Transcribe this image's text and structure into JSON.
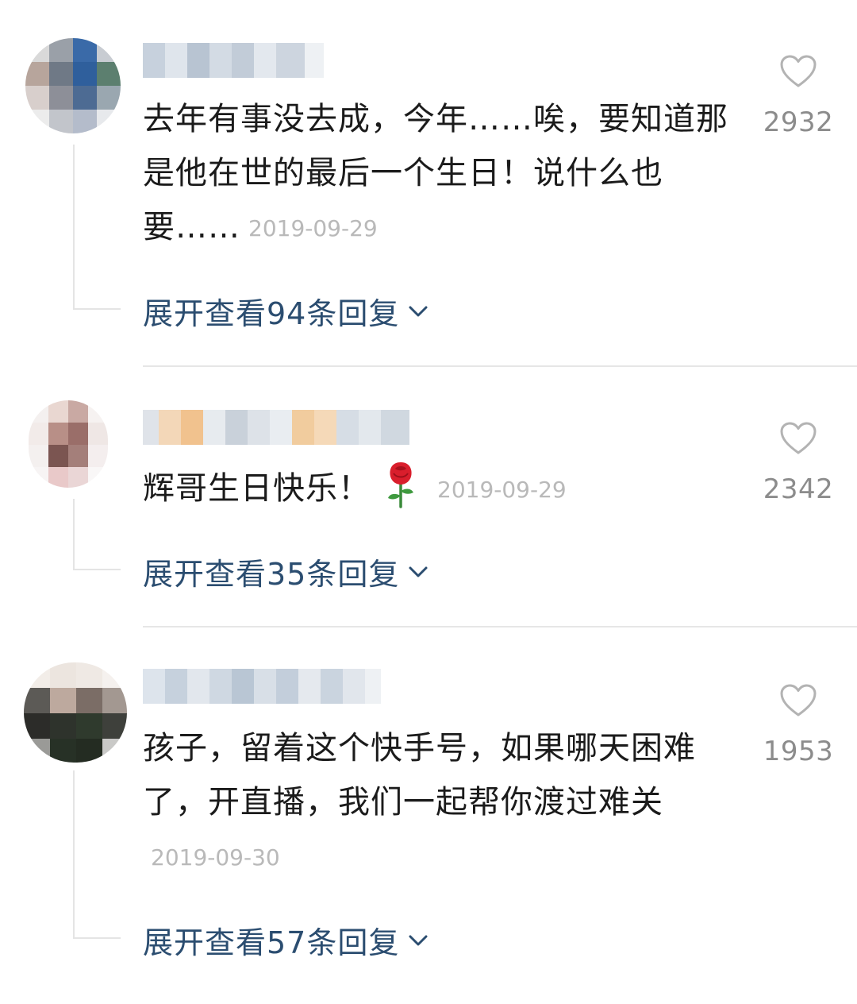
{
  "comments": [
    {
      "text": "去年有事没去成，今年……唉，要知道那是他在世的最后一个生日！说什么也要……",
      "timestamp": "2019-09-29",
      "likes": "2932",
      "expand_label": "展开查看94条回复"
    },
    {
      "text": "辉哥生日快乐！",
      "emoji": "rose",
      "timestamp": "2019-09-29",
      "likes": "2342",
      "expand_label": "展开查看35条回复"
    },
    {
      "text": "孩子，留着这个快手号，如果哪天困难了，开直播，我们一起帮你渡过难关",
      "timestamp": "2019-09-30",
      "likes": "1953",
      "expand_label": "展开查看57条回复"
    }
  ],
  "icons": {
    "like": "heart-outline-icon",
    "expand": "chevron-down-icon"
  },
  "colors": {
    "link": "#2b4d70",
    "timestamp": "#b9b9b9",
    "like_count": "#8c8c8c",
    "text": "#1b1b1b"
  }
}
